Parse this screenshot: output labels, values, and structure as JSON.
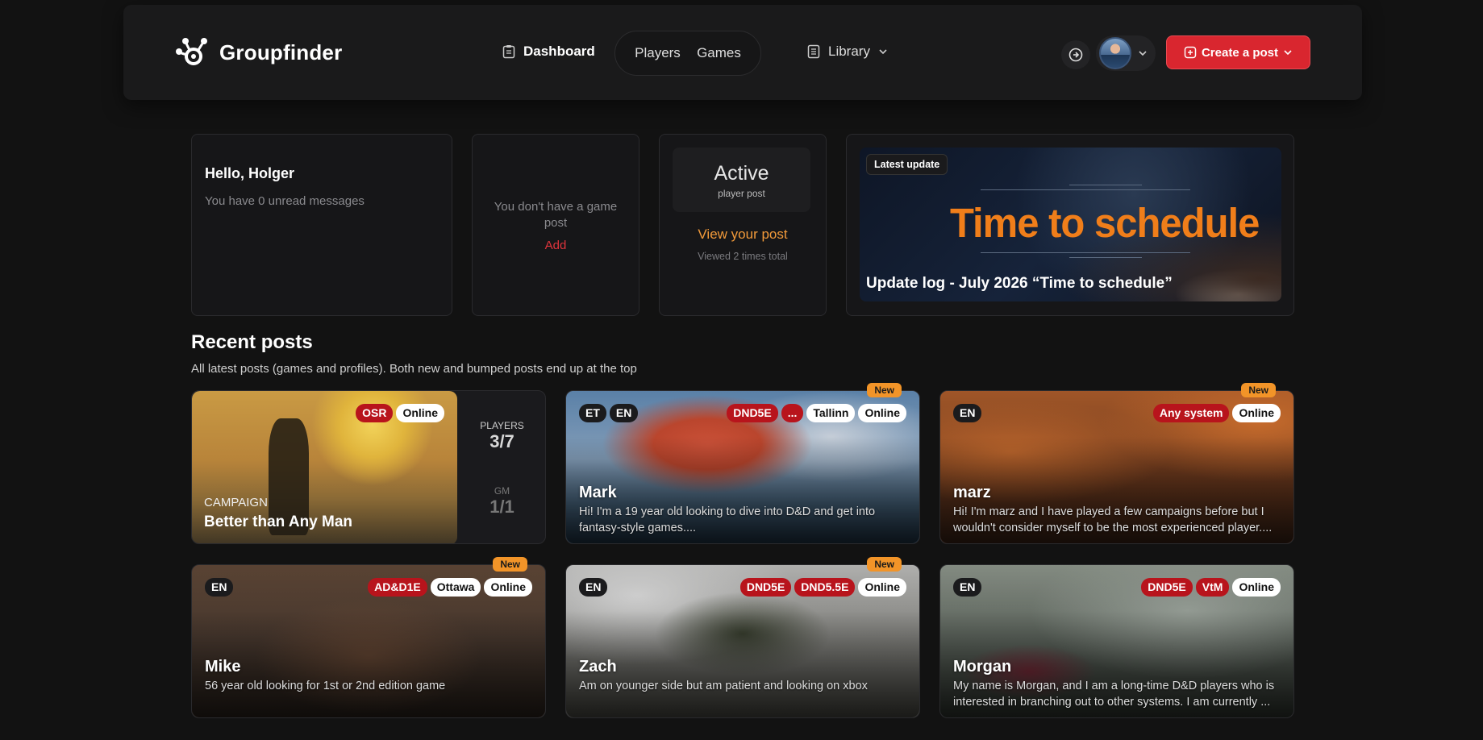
{
  "header": {
    "brand": "Groupfinder",
    "nav": {
      "dashboard": "Dashboard",
      "players": "Players",
      "games": "Games",
      "library": "Library"
    },
    "create_label": "Create a post"
  },
  "hello": {
    "title": "Hello, Holger",
    "sub": "You have 0 unread messages"
  },
  "game_card": {
    "text": "You don't have a game post",
    "add": "Add"
  },
  "player_card": {
    "status": "Active",
    "status_sub": "player post",
    "link": "View your post",
    "views": "Viewed 2 times total"
  },
  "update": {
    "tag": "Latest update",
    "headline": "Time to schedule",
    "caption": "Update log - July 2026 “Time to schedule”"
  },
  "recent": {
    "title": "Recent posts",
    "sub": "All latest posts (games and profiles). Both new and bumped posts end up at the top"
  },
  "campaign": {
    "tags": [
      "OSR",
      "Online"
    ],
    "label": "CAMPAIGN",
    "title": "Better than Any Man",
    "players_label": "PLAYERS",
    "players": "3/7",
    "gm_label": "GM",
    "gm": "1/1"
  },
  "posts": [
    {
      "name": "Mark",
      "new": "New",
      "lang": [
        "ET",
        "EN"
      ],
      "tags_red": [
        "DND5E",
        "..."
      ],
      "tags_white": [
        "Tallinn",
        "Online"
      ],
      "desc": "Hi! I'm a 19 year old looking to dive into D&D and get into fantasy-style games...."
    },
    {
      "name": "marz",
      "new": "New",
      "lang": [
        "EN"
      ],
      "tags_red": [
        "Any system"
      ],
      "tags_white": [
        "Online"
      ],
      "desc": "Hi! I'm marz and I have played a few campaigns before but I wouldn't consider myself to be the most experienced player...."
    },
    {
      "name": "Mike",
      "new": "New",
      "lang": [
        "EN"
      ],
      "tags_red": [
        "AD&D1E"
      ],
      "tags_white": [
        "Ottawa",
        "Online"
      ],
      "desc": "56 year old looking for 1st or 2nd edition game"
    },
    {
      "name": "Zach",
      "new": "New",
      "lang": [
        "EN"
      ],
      "tags_red": [
        "DND5E",
        "DND5.5E"
      ],
      "tags_white": [
        "Online"
      ],
      "desc": "Am on younger side but am patient and looking on xbox"
    },
    {
      "name": "Morgan",
      "new": "",
      "lang": [
        "EN"
      ],
      "tags_red": [
        "DND5E",
        "VtM"
      ],
      "tags_white": [
        "Online"
      ],
      "desc": "My name is Morgan, and I am a long-time D&D players who is interested in branching out to other systems. I am currently ..."
    }
  ],
  "colors": {
    "accent_red": "#d9262f",
    "accent_orange": "#f29a3a",
    "new_badge": "#f29428"
  }
}
